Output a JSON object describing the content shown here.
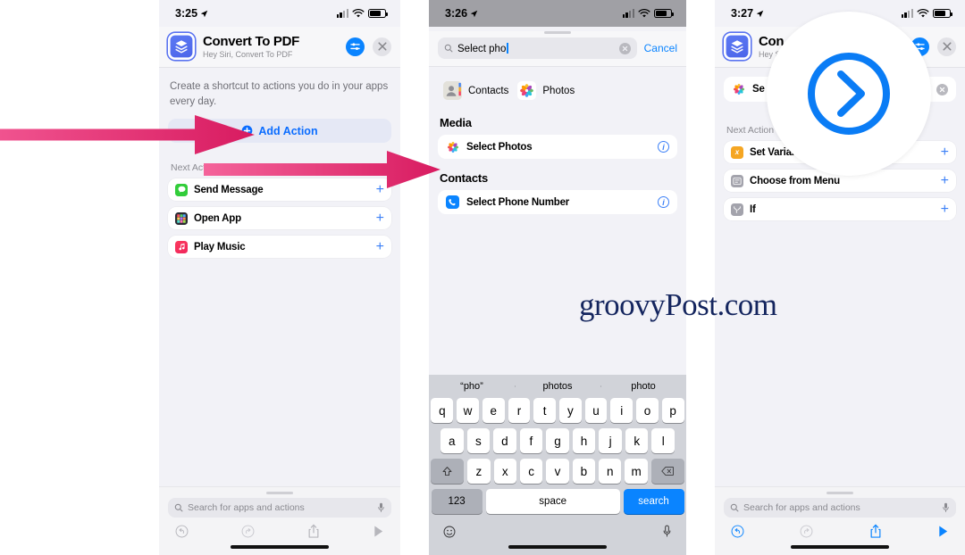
{
  "watermark": "groovyPost.com",
  "colors": {
    "accent_blue": "#0a84ff",
    "arrow_pink": "#e0256e",
    "background_gray": "#f2f2f7",
    "orange_icon": "#f5a623"
  },
  "panels": [
    {
      "id": "panel-shortcut-editor",
      "status_bar": {
        "time": "3:25",
        "location_icon": "location-arrow-icon",
        "cellular_icon": "signal-bars-icon",
        "wifi_icon": "wifi-icon",
        "battery_icon": "battery-icon"
      },
      "header": {
        "app_icon": "shortcuts-stack-icon",
        "title": "Convert To PDF",
        "subtitle": "Hey Siri, Convert To PDF",
        "settings_icon": "sliders-icon",
        "close_icon": "close-icon"
      },
      "blurb": "Create a shortcut to actions you do in your apps every day.",
      "add_action": {
        "label": "Add Action",
        "icon": "plus-circle-icon"
      },
      "suggestions_label": "Next Action Suggestions",
      "suggestions": [
        {
          "label": "Send Message",
          "icon": "messages-icon",
          "add_icon": "plus-icon"
        },
        {
          "label": "Open App",
          "icon": "app-grid-icon",
          "add_icon": "plus-icon"
        },
        {
          "label": "Play Music",
          "icon": "music-icon",
          "add_icon": "plus-icon"
        }
      ],
      "bottom": {
        "search_placeholder": "Search for apps and actions",
        "search_icon": "search-icon",
        "mic_icon": "microphone-icon",
        "toolbar": [
          {
            "name": "undo-button",
            "icon": "undo-icon",
            "state": "disabled"
          },
          {
            "name": "redo-button",
            "icon": "redo-icon",
            "state": "disabled"
          },
          {
            "name": "share-button",
            "icon": "share-icon",
            "state": "disabled"
          },
          {
            "name": "run-button",
            "icon": "play-icon",
            "state": "disabled"
          }
        ]
      }
    },
    {
      "id": "panel-action-search",
      "status_bar": {
        "time": "3:26",
        "location_icon": "location-arrow-icon",
        "cellular_icon": "signal-bars-icon",
        "wifi_icon": "wifi-icon",
        "battery_icon": "battery-icon"
      },
      "search": {
        "icon": "search-icon",
        "value": "Select pho",
        "clear_icon": "clear-circle-icon",
        "cancel_label": "Cancel"
      },
      "apps": [
        {
          "label": "Contacts",
          "icon": "contacts-icon"
        },
        {
          "label": "Photos",
          "icon": "photos-icon"
        }
      ],
      "groups": [
        {
          "title": "Media",
          "results": [
            {
              "label": "Select Photos",
              "icon": "photos-icon",
              "info_icon": "info-icon"
            }
          ]
        },
        {
          "title": "Contacts",
          "results": [
            {
              "label": "Select Phone Number",
              "icon": "phone-icon",
              "info_icon": "info-icon"
            }
          ]
        }
      ],
      "keyboard": {
        "suggestions": [
          "“pho”",
          "photos",
          "photo"
        ],
        "row1": [
          "q",
          "w",
          "e",
          "r",
          "t",
          "y",
          "u",
          "i",
          "o",
          "p"
        ],
        "row2": [
          "a",
          "s",
          "d",
          "f",
          "g",
          "h",
          "j",
          "k",
          "l"
        ],
        "row3": [
          "z",
          "x",
          "c",
          "v",
          "b",
          "n",
          "m"
        ],
        "shift_icon": "shift-icon",
        "backspace_icon": "backspace-icon",
        "numbers_key": "123",
        "space_key": "space",
        "return_key": "search",
        "emoji_icon": "emoji-icon",
        "dictation_icon": "microphone-icon"
      }
    },
    {
      "id": "panel-shortcut-with-action",
      "status_bar": {
        "time": "3:27",
        "location_icon": "location-arrow-icon",
        "cellular_icon": "signal-bars-icon",
        "wifi_icon": "wifi-icon",
        "battery_icon": "battery-icon"
      },
      "header": {
        "app_icon": "shortcuts-stack-icon",
        "title": "Con",
        "subtitle": "Hey S",
        "settings_icon": "sliders-icon",
        "close_icon": "close-icon"
      },
      "search_field": {
        "icon": "photos-icon",
        "value": "Se",
        "clear_icon": "clear-circle-icon"
      },
      "suggestions_label": "Next Action S",
      "suggestions": [
        {
          "label": "Set Variable",
          "icon": "variable-icon",
          "add_icon": "plus-icon"
        },
        {
          "label": "Choose from Menu",
          "icon": "menu-list-icon",
          "add_icon": "plus-icon"
        },
        {
          "label": "If",
          "icon": "if-branch-icon",
          "add_icon": "plus-icon"
        }
      ],
      "bottom": {
        "search_placeholder": "Search for apps and actions",
        "search_icon": "search-icon",
        "mic_icon": "microphone-icon",
        "toolbar": [
          {
            "name": "undo-button",
            "icon": "undo-icon",
            "state": "active"
          },
          {
            "name": "redo-button",
            "icon": "redo-icon",
            "state": "disabled"
          },
          {
            "name": "share-button",
            "icon": "share-icon",
            "state": "active"
          },
          {
            "name": "run-button",
            "icon": "play-icon",
            "state": "active"
          }
        ]
      },
      "overlay_bubble": {
        "icon": "chevron-right-circle-icon"
      }
    }
  ],
  "annotations": [
    {
      "name": "arrow-to-add-action",
      "icon": "arrow-right-icon"
    },
    {
      "name": "arrow-to-select-photos",
      "icon": "arrow-right-icon"
    }
  ]
}
